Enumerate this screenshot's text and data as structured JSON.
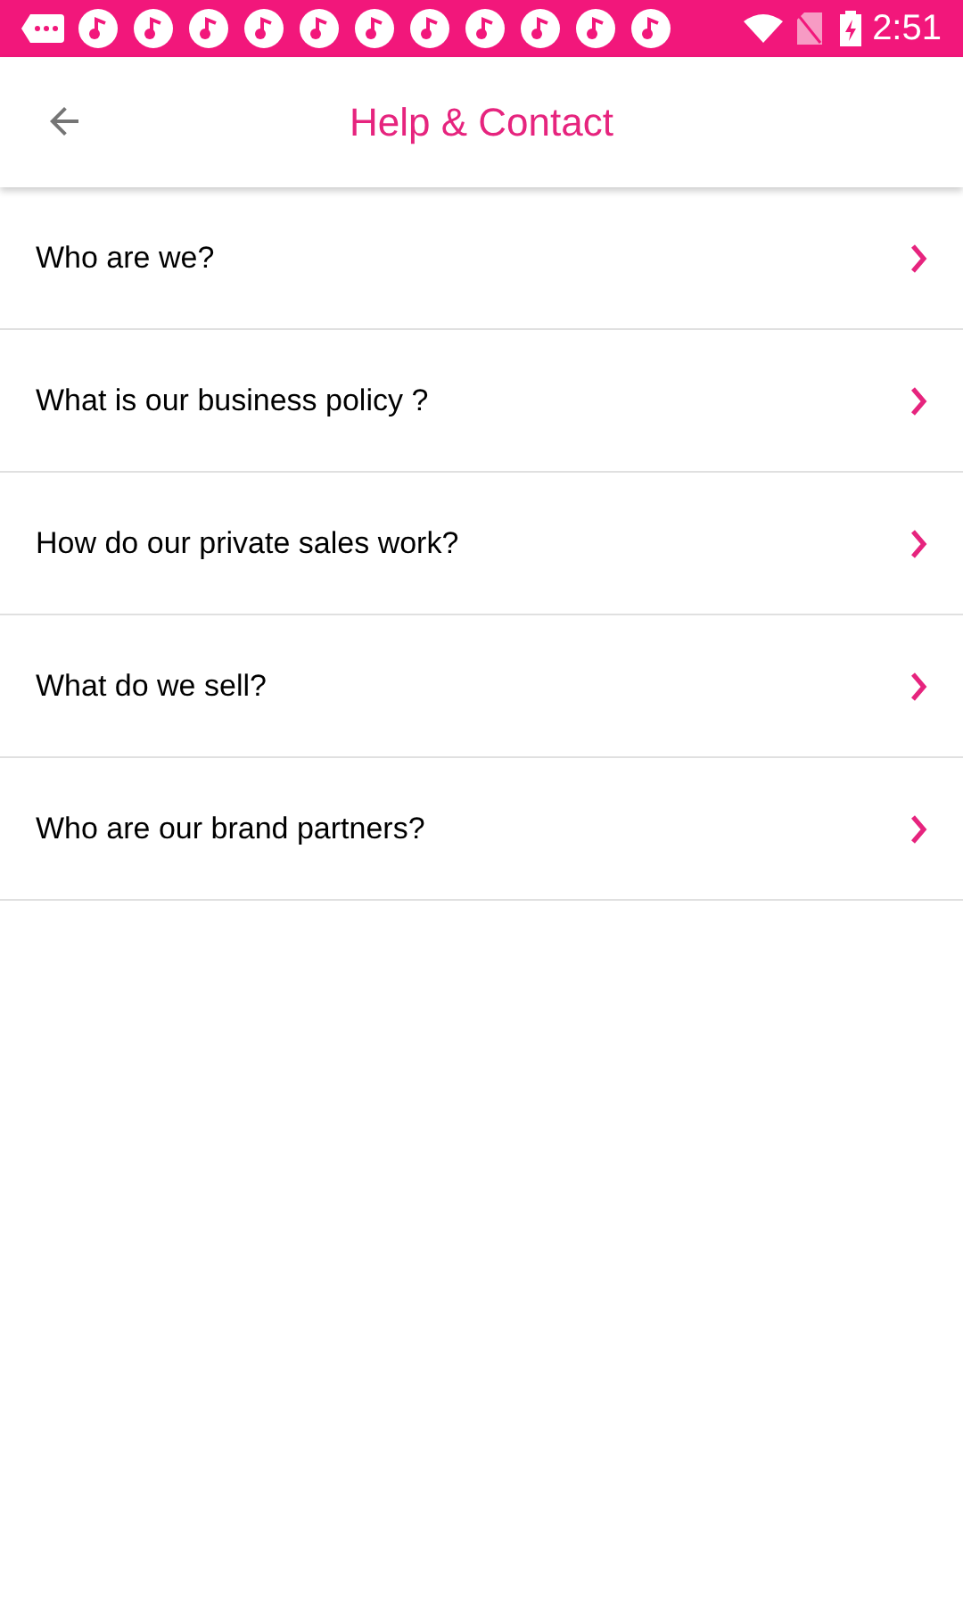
{
  "status_bar": {
    "time": "2:51"
  },
  "app_bar": {
    "title": "Help & Contact"
  },
  "items": [
    {
      "label": "Who are we?"
    },
    {
      "label": "What is our business policy ?"
    },
    {
      "label": "How do our private sales work?"
    },
    {
      "label": "What do we sell?"
    },
    {
      "label": "Who are our brand partners?"
    }
  ]
}
